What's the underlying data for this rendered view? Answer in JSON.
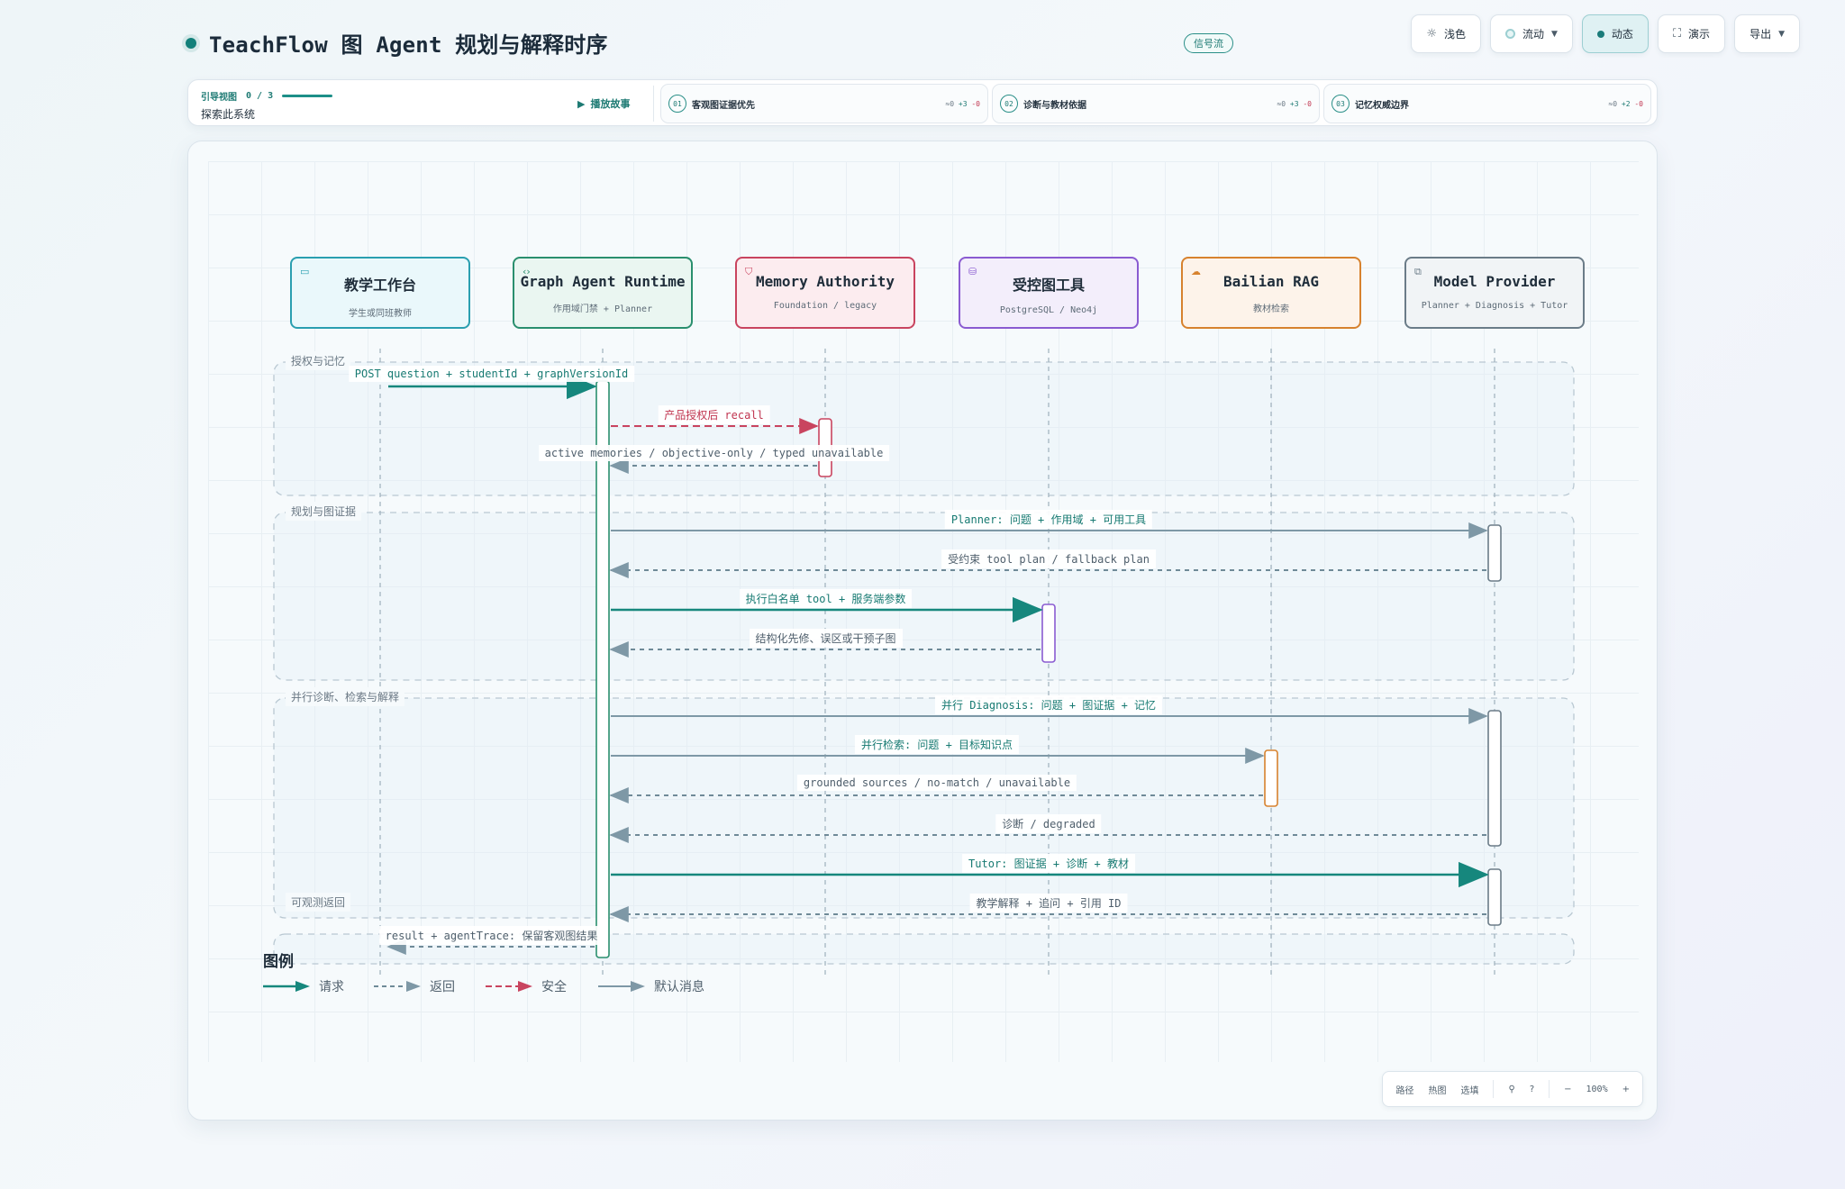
{
  "header": {
    "title": "TeachFlow 图 Agent 规划与解释时序",
    "signal_badge": "信号流",
    "toolbar": {
      "light": "浅色",
      "flow": "流动",
      "dynamic": "动态",
      "present": "演示",
      "export": "导出"
    }
  },
  "story": {
    "guide_label": "引导视图",
    "guide_progress": "0 / 3",
    "guide_subtitle": "探索此系统",
    "play_label": "播放故事",
    "chapters": [
      {
        "num": "01",
        "label": "客观图证据优先",
        "stat_base": "≈0",
        "stat_plus": "+3",
        "stat_minus": "-0"
      },
      {
        "num": "02",
        "label": "诊断与教材依据",
        "stat_base": "≈0",
        "stat_plus": "+3",
        "stat_minus": "-0"
      },
      {
        "num": "03",
        "label": "记忆权威边界",
        "stat_base": "≈0",
        "stat_plus": "+2",
        "stat_minus": "-0"
      }
    ]
  },
  "participants": [
    {
      "name": "教学工作台",
      "sub": "学生或同班教师",
      "icon": "window-icon",
      "color": "#2a9fb0",
      "fill": "#eaf8fb"
    },
    {
      "name": "Graph Agent Runtime",
      "sub": "作用域门禁 + Planner",
      "icon": "code-icon",
      "color": "#2a8f6e",
      "fill": "#eaf6f1"
    },
    {
      "name": "Memory Authority",
      "sub": "Foundation / legacy",
      "icon": "shield-icon",
      "color": "#c9445f",
      "fill": "#fcecef"
    },
    {
      "name": "受控图工具",
      "sub": "PostgreSQL / Neo4j",
      "icon": "database-icon",
      "color": "#8a5bd1",
      "fill": "#f3eefb"
    },
    {
      "name": "Bailian RAG",
      "sub": "教材检索",
      "icon": "cloud-icon",
      "color": "#d7822e",
      "fill": "#fdf3ea"
    },
    {
      "name": "Model Provider",
      "sub": "Planner + Diagnosis + Tutor",
      "icon": "external-icon",
      "color": "#6b7c88",
      "fill": "#f1f4f6"
    }
  ],
  "groups": [
    "授权与记忆",
    "规划与图证据",
    "并行诊断、检索与解释",
    "可观测返回"
  ],
  "messages": [
    {
      "from": 0,
      "to": 1,
      "kind": "req",
      "label": "POST question + studentId + graphVersionId"
    },
    {
      "from": 1,
      "to": 2,
      "kind": "sec",
      "label": "产品授权后 recall"
    },
    {
      "from": 2,
      "to": 1,
      "kind": "ret",
      "label": "active memories / objective-only / typed unavailable"
    },
    {
      "from": 1,
      "to": 5,
      "kind": "def",
      "label": "Planner: 问题 + 作用域 + 可用工具"
    },
    {
      "from": 5,
      "to": 1,
      "kind": "ret",
      "label": "受约束 tool plan / fallback plan"
    },
    {
      "from": 1,
      "to": 3,
      "kind": "req",
      "label": "执行白名单 tool + 服务端参数"
    },
    {
      "from": 3,
      "to": 1,
      "kind": "ret",
      "label": "结构化先修、误区或干预子图"
    },
    {
      "from": 1,
      "to": 5,
      "kind": "def",
      "label": "并行 Diagnosis: 问题 + 图证据 + 记忆"
    },
    {
      "from": 1,
      "to": 4,
      "kind": "def",
      "label": "并行检索: 问题 + 目标知识点"
    },
    {
      "from": 4,
      "to": 1,
      "kind": "ret",
      "label": "grounded sources / no-match / unavailable"
    },
    {
      "from": 5,
      "to": 1,
      "kind": "ret",
      "label": "诊断 / degraded"
    },
    {
      "from": 1,
      "to": 5,
      "kind": "req",
      "label": "Tutor: 图证据 + 诊断 + 教材"
    },
    {
      "from": 5,
      "to": 1,
      "kind": "ret",
      "label": "教学解释 + 追问 + 引用 ID"
    },
    {
      "from": 1,
      "to": 0,
      "kind": "ret",
      "label": "result + agentTrace: 保留客观图结果"
    }
  ],
  "legend": {
    "title": "图例",
    "request": "请求",
    "return": "返回",
    "security": "安全",
    "default": "默认消息"
  },
  "colors": {
    "request": "#16877d",
    "return": "#6f8a98",
    "security": "#c9445f",
    "default": "#7e98a6"
  },
  "zoombar": {
    "path": "路径",
    "layers": "热图",
    "filter": "选填",
    "zoom": "100%"
  }
}
